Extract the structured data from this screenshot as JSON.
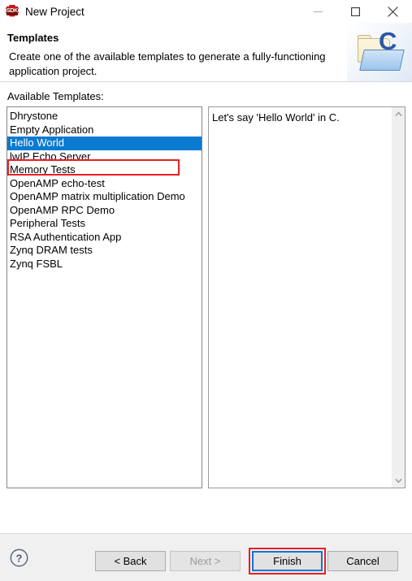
{
  "window": {
    "title": "New Project",
    "icon_name": "sdk-app-icon",
    "icon_text": "SDK",
    "controls": {
      "minimize": "minimize-icon",
      "maximize": "maximize-icon",
      "close": "close-icon"
    }
  },
  "header": {
    "title": "Templates",
    "description": "Create one of the available templates to generate a fully-functioning application project.",
    "graphic": "c-project-folder-icon",
    "graphic_letter": "C"
  },
  "main": {
    "available_label": "Available Templates:",
    "templates": [
      "Dhrystone",
      "Empty Application",
      "Hello World",
      "lwIP Echo Server",
      "Memory Tests",
      "OpenAMP echo-test",
      "OpenAMP matrix multiplication Demo",
      "OpenAMP RPC Demo",
      "Peripheral Tests",
      "RSA Authentication App",
      "Zynq DRAM tests",
      "Zynq FSBL"
    ],
    "selected_index": 2,
    "selected_template": "Hello World",
    "description_text": "Let's say 'Hello World' in C.",
    "scrollbar": {
      "up_arrow": "chevron-up-icon",
      "down_arrow": "chevron-down-icon"
    }
  },
  "footer": {
    "help_label": "?",
    "back_label": "< Back",
    "next_label": "Next >",
    "next_disabled": true,
    "finish_label": "Finish",
    "cancel_label": "Cancel"
  },
  "annotations": {
    "highlight_color": "#ec1c24",
    "selection_color": "#0b7ad1",
    "focus_color": "#0078d7",
    "targets": [
      "Hello World",
      "Finish"
    ]
  }
}
